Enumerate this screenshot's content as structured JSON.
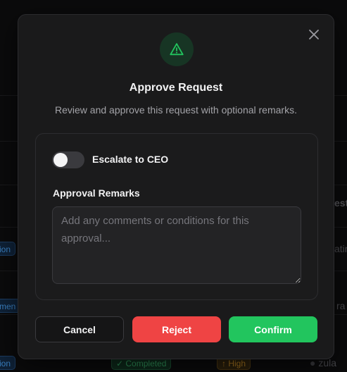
{
  "background": {
    "chips": [
      {
        "text": "ion",
        "style": "blue"
      },
      {
        "text": "men",
        "style": "blue"
      },
      {
        "text": "ion",
        "style": "blue"
      },
      {
        "text": "Completed",
        "style": "green"
      },
      {
        "text": "High",
        "style": "amber"
      }
    ],
    "fragments": [
      "est",
      "atin",
      "ra",
      "zula"
    ]
  },
  "modal": {
    "title": "Approve Request",
    "subtitle": "Review and approve this request with optional remarks.",
    "escalate": {
      "label": "Escalate to CEO",
      "enabled": false
    },
    "remarks": {
      "label": "Approval Remarks",
      "placeholder": "Add any comments or conditions for this approval...",
      "value": ""
    },
    "buttons": {
      "cancel": "Cancel",
      "reject": "Reject",
      "confirm": "Confirm"
    },
    "icons": {
      "header": "warning-triangle-icon",
      "close": "close-icon"
    },
    "colors": {
      "confirm": "#22c55e",
      "reject": "#ef4444",
      "warning": "#22c55e"
    }
  }
}
